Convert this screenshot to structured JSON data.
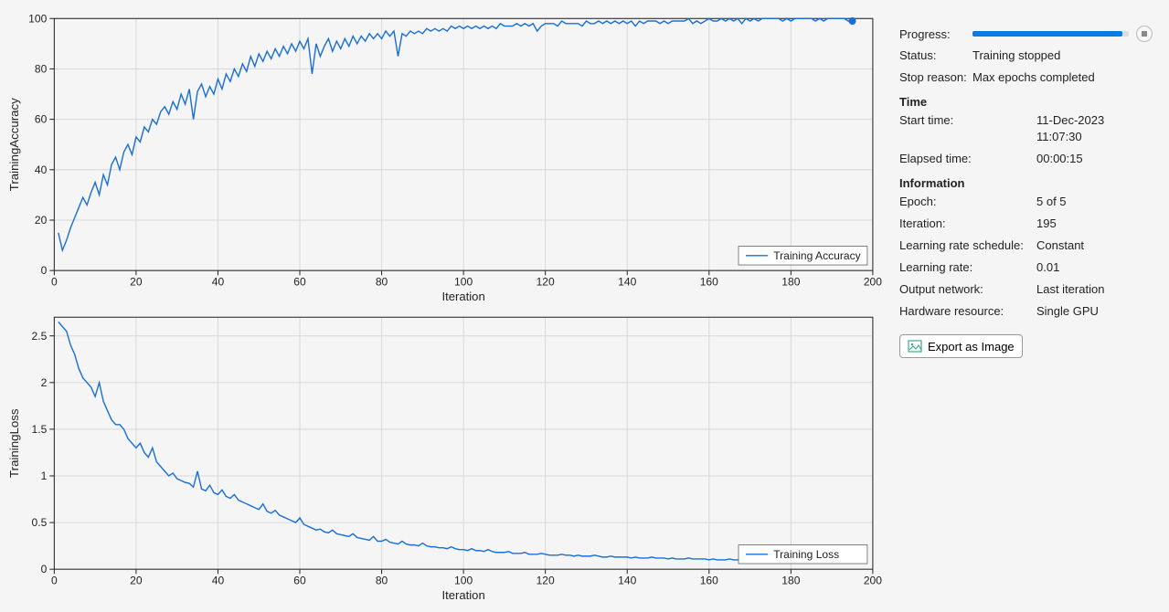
{
  "side": {
    "progress_label": "Progress:",
    "status_label": "Status:",
    "status_value": "Training stopped",
    "stop_reason_label": "Stop reason:",
    "stop_reason_value": "Max epochs completed",
    "time_head": "Time",
    "start_time_label": "Start time:",
    "start_time_value": "11-Dec-2023 11:07:30",
    "elapsed_label": "Elapsed time:",
    "elapsed_value": "00:00:15",
    "info_head": "Information",
    "epoch_label": "Epoch:",
    "epoch_value": "5 of 5",
    "iteration_label": "Iteration:",
    "iteration_value": "195",
    "lr_sched_label": "Learning rate schedule:",
    "lr_sched_value": "Constant",
    "lr_label": "Learning rate:",
    "lr_value": "0.01",
    "output_net_label": "Output network:",
    "output_net_value": "Last iteration",
    "hw_label": "Hardware resource:",
    "hw_value": "Single GPU",
    "export_label": "Export as Image"
  },
  "chart_data": [
    {
      "type": "line",
      "title": "",
      "xlabel": "Iteration",
      "ylabel": "TrainingAccuracy",
      "xlim": [
        0,
        200
      ],
      "ylim": [
        0,
        100
      ],
      "xticks": [
        0,
        20,
        40,
        60,
        80,
        100,
        120,
        140,
        160,
        180,
        200
      ],
      "yticks": [
        0,
        20,
        40,
        60,
        80,
        100
      ],
      "legend": "Training Accuracy",
      "x": [
        1,
        2,
        3,
        4,
        5,
        6,
        7,
        8,
        9,
        10,
        11,
        12,
        13,
        14,
        15,
        16,
        17,
        18,
        19,
        20,
        21,
        22,
        23,
        24,
        25,
        26,
        27,
        28,
        29,
        30,
        31,
        32,
        33,
        34,
        35,
        36,
        37,
        38,
        39,
        40,
        41,
        42,
        43,
        44,
        45,
        46,
        47,
        48,
        49,
        50,
        51,
        52,
        53,
        54,
        55,
        56,
        57,
        58,
        59,
        60,
        61,
        62,
        63,
        64,
        65,
        66,
        67,
        68,
        69,
        70,
        71,
        72,
        73,
        74,
        75,
        76,
        77,
        78,
        79,
        80,
        81,
        82,
        83,
        84,
        85,
        86,
        87,
        88,
        89,
        90,
        91,
        92,
        93,
        94,
        95,
        96,
        97,
        98,
        99,
        100,
        101,
        102,
        103,
        104,
        105,
        106,
        107,
        108,
        109,
        110,
        111,
        112,
        113,
        114,
        115,
        116,
        117,
        118,
        119,
        120,
        121,
        122,
        123,
        124,
        125,
        126,
        127,
        128,
        129,
        130,
        131,
        132,
        133,
        134,
        135,
        136,
        137,
        138,
        139,
        140,
        141,
        142,
        143,
        144,
        145,
        146,
        147,
        148,
        149,
        150,
        151,
        152,
        153,
        154,
        155,
        156,
        157,
        158,
        159,
        160,
        161,
        162,
        163,
        164,
        165,
        166,
        167,
        168,
        169,
        170,
        171,
        172,
        173,
        174,
        175,
        176,
        177,
        178,
        179,
        180,
        181,
        182,
        183,
        184,
        185,
        186,
        187,
        188,
        189,
        190,
        191,
        192,
        193,
        194,
        195
      ],
      "y": [
        15,
        8,
        12,
        17,
        21,
        25,
        29,
        26,
        31,
        35,
        30,
        38,
        34,
        42,
        45,
        40,
        47,
        50,
        46,
        53,
        51,
        57,
        55,
        60,
        58,
        63,
        65,
        62,
        67,
        64,
        70,
        66,
        72,
        60,
        71,
        74,
        69,
        73,
        70,
        76,
        72,
        78,
        75,
        80,
        77,
        82,
        79,
        85,
        81,
        86,
        83,
        87,
        84,
        88,
        85,
        89,
        86,
        90,
        87,
        91,
        88,
        92,
        78,
        90,
        85,
        89,
        92,
        87,
        91,
        88,
        92,
        89,
        93,
        90,
        93,
        91,
        94,
        92,
        94,
        92,
        95,
        93,
        95,
        85,
        94,
        93,
        95,
        94,
        95,
        94,
        96,
        95,
        96,
        95,
        96,
        95,
        97,
        96,
        97,
        96,
        97,
        96,
        97,
        96,
        97,
        96,
        97,
        96,
        98,
        97,
        97,
        97,
        98,
        97,
        98,
        97,
        98,
        95,
        97,
        98,
        98,
        98,
        97,
        99,
        98,
        98,
        98,
        98,
        97,
        99,
        98,
        98,
        99,
        98,
        99,
        98,
        99,
        98,
        99,
        98,
        99,
        97,
        99,
        98,
        99,
        99,
        99,
        98,
        99,
        98,
        99,
        99,
        99,
        99,
        100,
        98,
        99,
        98,
        99,
        100,
        99,
        99,
        100,
        99,
        100,
        99,
        100,
        98,
        100,
        99,
        100,
        99,
        100,
        100,
        100,
        100,
        100,
        99,
        100,
        99,
        100,
        100,
        100,
        100,
        100,
        99,
        100,
        99,
        100,
        100,
        100,
        100,
        100,
        99,
        99
      ]
    },
    {
      "type": "line",
      "title": "",
      "xlabel": "Iteration",
      "ylabel": "TrainingLoss",
      "xlim": [
        0,
        200
      ],
      "ylim": [
        0,
        2.7
      ],
      "xticks": [
        0,
        20,
        40,
        60,
        80,
        100,
        120,
        140,
        160,
        180,
        200
      ],
      "yticks": [
        0,
        0.5,
        1,
        1.5,
        2,
        2.5
      ],
      "legend": "Training Loss",
      "x": [
        1,
        2,
        3,
        4,
        5,
        6,
        7,
        8,
        9,
        10,
        11,
        12,
        13,
        14,
        15,
        16,
        17,
        18,
        19,
        20,
        21,
        22,
        23,
        24,
        25,
        26,
        27,
        28,
        29,
        30,
        31,
        32,
        33,
        34,
        35,
        36,
        37,
        38,
        39,
        40,
        41,
        42,
        43,
        44,
        45,
        46,
        47,
        48,
        49,
        50,
        51,
        52,
        53,
        54,
        55,
        56,
        57,
        58,
        59,
        60,
        61,
        62,
        63,
        64,
        65,
        66,
        67,
        68,
        69,
        70,
        71,
        72,
        73,
        74,
        75,
        76,
        77,
        78,
        79,
        80,
        81,
        82,
        83,
        84,
        85,
        86,
        87,
        88,
        89,
        90,
        91,
        92,
        93,
        94,
        95,
        96,
        97,
        98,
        99,
        100,
        101,
        102,
        103,
        104,
        105,
        106,
        107,
        108,
        109,
        110,
        111,
        112,
        113,
        114,
        115,
        116,
        117,
        118,
        119,
        120,
        121,
        122,
        123,
        124,
        125,
        126,
        127,
        128,
        129,
        130,
        131,
        132,
        133,
        134,
        135,
        136,
        137,
        138,
        139,
        140,
        141,
        142,
        143,
        144,
        145,
        146,
        147,
        148,
        149,
        150,
        151,
        152,
        153,
        154,
        155,
        156,
        157,
        158,
        159,
        160,
        161,
        162,
        163,
        164,
        165,
        166,
        167,
        168,
        169,
        170,
        171,
        172,
        173,
        174,
        175,
        176,
        177,
        178,
        179,
        180,
        181,
        182,
        183,
        184,
        185,
        186,
        187,
        188,
        189,
        190,
        191,
        192,
        193,
        194,
        195
      ],
      "y": [
        2.65,
        2.6,
        2.55,
        2.4,
        2.3,
        2.15,
        2.05,
        2.0,
        1.95,
        1.85,
        2.0,
        1.8,
        1.7,
        1.6,
        1.55,
        1.55,
        1.5,
        1.4,
        1.35,
        1.3,
        1.35,
        1.25,
        1.2,
        1.3,
        1.15,
        1.1,
        1.05,
        1.0,
        1.03,
        0.97,
        0.95,
        0.93,
        0.92,
        0.88,
        1.05,
        0.86,
        0.84,
        0.9,
        0.82,
        0.8,
        0.85,
        0.78,
        0.76,
        0.8,
        0.74,
        0.72,
        0.7,
        0.68,
        0.66,
        0.64,
        0.7,
        0.62,
        0.6,
        0.63,
        0.58,
        0.56,
        0.54,
        0.52,
        0.5,
        0.55,
        0.48,
        0.46,
        0.44,
        0.42,
        0.43,
        0.4,
        0.39,
        0.42,
        0.38,
        0.37,
        0.36,
        0.35,
        0.38,
        0.34,
        0.33,
        0.32,
        0.31,
        0.35,
        0.3,
        0.3,
        0.32,
        0.29,
        0.28,
        0.27,
        0.3,
        0.27,
        0.26,
        0.26,
        0.25,
        0.28,
        0.25,
        0.24,
        0.24,
        0.23,
        0.23,
        0.22,
        0.24,
        0.22,
        0.21,
        0.21,
        0.2,
        0.22,
        0.2,
        0.2,
        0.19,
        0.21,
        0.19,
        0.18,
        0.18,
        0.18,
        0.19,
        0.17,
        0.17,
        0.17,
        0.18,
        0.16,
        0.16,
        0.16,
        0.17,
        0.16,
        0.15,
        0.15,
        0.15,
        0.16,
        0.15,
        0.15,
        0.14,
        0.15,
        0.14,
        0.14,
        0.14,
        0.15,
        0.14,
        0.13,
        0.13,
        0.14,
        0.13,
        0.13,
        0.13,
        0.13,
        0.12,
        0.13,
        0.12,
        0.12,
        0.12,
        0.13,
        0.12,
        0.12,
        0.12,
        0.11,
        0.12,
        0.11,
        0.11,
        0.11,
        0.12,
        0.11,
        0.11,
        0.11,
        0.11,
        0.1,
        0.11,
        0.1,
        0.1,
        0.1,
        0.11,
        0.1,
        0.1,
        0.1,
        0.1,
        0.09,
        0.1,
        0.1,
        0.1,
        0.09,
        0.1,
        0.1,
        0.09,
        0.1,
        0.1,
        0.09,
        0.1,
        0.1,
        0.09,
        0.09,
        0.09,
        0.09,
        0.1,
        0.1,
        0.09,
        0.09,
        0.09,
        0.09,
        0.09,
        0.1,
        0.1
      ]
    }
  ]
}
